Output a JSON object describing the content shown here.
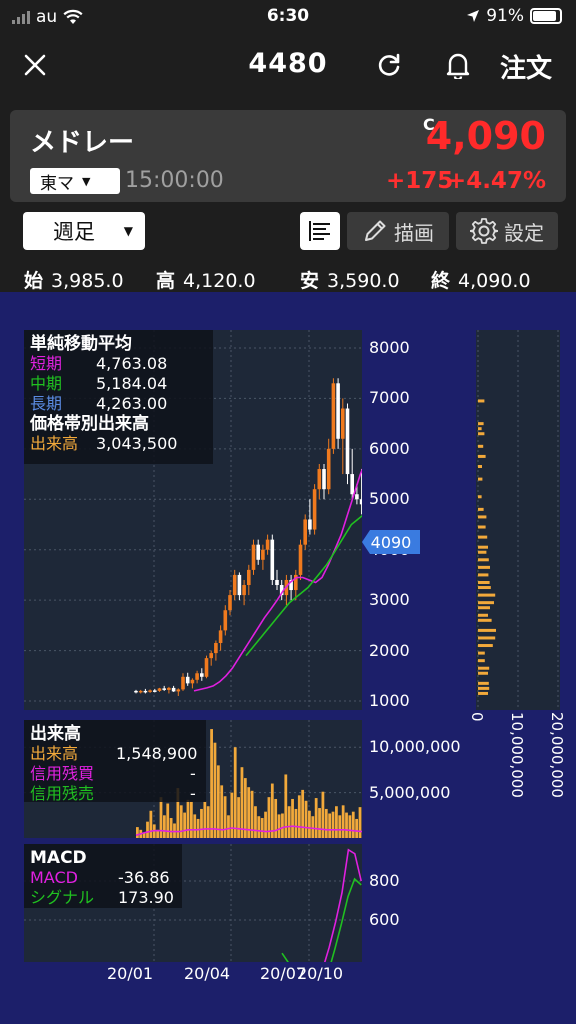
{
  "status": {
    "carrier": "au",
    "time": "6:30",
    "battery": "91%"
  },
  "header": {
    "title": "4480",
    "order_label": "注文"
  },
  "quote": {
    "name": "メドレー",
    "market": "東マ",
    "time": "15:00:00",
    "c_mark": "C",
    "price": "4,090",
    "change": "+175",
    "change_pct": "+4.47%"
  },
  "toolbar": {
    "period": "週足",
    "draw_label": "描画",
    "settings_label": "設定"
  },
  "ohlc": {
    "open_label": "始",
    "open": "3,985.0",
    "high_label": "高",
    "high": "4,120.0",
    "low_label": "安",
    "low": "3,590.0",
    "close_label": "終",
    "close": "4,090.0"
  },
  "price_legend": {
    "title": "単純移動平均",
    "short_label": "短期",
    "short": "4,763.08",
    "mid_label": "中期",
    "mid": "5,184.04",
    "long_label": "長期",
    "long": "4,263.00",
    "vbp_title": "価格帯別出来高",
    "vbp_label": "出来高",
    "vbp": "3,043,500"
  },
  "volume_legend": {
    "title": "出来高",
    "vol_label": "出来高",
    "vol": "1,548,900",
    "buy_label": "信用残買",
    "buy": "-",
    "sell_label": "信用残売",
    "sell": "-"
  },
  "macd_legend": {
    "title": "MACD",
    "macd_label": "MACD",
    "macd": "-36.86",
    "signal_label": "シグナル",
    "signal": "173.90"
  },
  "price_tag": "4090",
  "colors": {
    "up": "#f07a1e",
    "down": "#ffffff",
    "short_ma": "#e020e0",
    "mid_ma": "#20c020",
    "long_ma": "#5a8ae0",
    "volume": "#f2a93b",
    "price_red": "#ff2a2a"
  },
  "chart_data": [
    {
      "type": "candlestick",
      "title": "",
      "y_ticks": [
        "8000",
        "7000",
        "6000",
        "5000",
        "4000",
        "3000",
        "2000",
        "1000"
      ],
      "ylim": [
        1000,
        8000
      ],
      "x_ticks": [
        "20/01",
        "20/04",
        "20/07",
        "20/10"
      ],
      "candles": [
        [
          1200,
          1220,
          1150,
          1180
        ],
        [
          1180,
          1220,
          1150,
          1200
        ],
        [
          1200,
          1240,
          1150,
          1190
        ],
        [
          1190,
          1230,
          1160,
          1210
        ],
        [
          1210,
          1240,
          1170,
          1200
        ],
        [
          1200,
          1260,
          1180,
          1250
        ],
        [
          1250,
          1300,
          1200,
          1220
        ],
        [
          1220,
          1280,
          1150,
          1260
        ],
        [
          1260,
          1300,
          1180,
          1190
        ],
        [
          1190,
          1250,
          1100,
          1230
        ],
        [
          1230,
          1550,
          1200,
          1480
        ],
        [
          1480,
          1560,
          1300,
          1350
        ],
        [
          1350,
          1450,
          1250,
          1420
        ],
        [
          1420,
          1600,
          1350,
          1550
        ],
        [
          1550,
          1650,
          1400,
          1480
        ],
        [
          1480,
          1900,
          1450,
          1850
        ],
        [
          1850,
          2000,
          1700,
          1950
        ],
        [
          1950,
          2200,
          1800,
          2150
        ],
        [
          2150,
          2500,
          2000,
          2400
        ],
        [
          2400,
          2900,
          2300,
          2800
        ],
        [
          2800,
          3200,
          2700,
          3100
        ],
        [
          3100,
          3600,
          3000,
          3500
        ],
        [
          3500,
          3550,
          3000,
          3100
        ],
        [
          3100,
          3400,
          2900,
          3300
        ],
        [
          3300,
          3700,
          3100,
          3600
        ],
        [
          3600,
          4200,
          3500,
          4100
        ],
        [
          4100,
          4200,
          3700,
          3800
        ],
        [
          3800,
          4100,
          3600,
          4000
        ],
        [
          4000,
          4300,
          3900,
          4200
        ],
        [
          4200,
          4300,
          3300,
          3400
        ],
        [
          3400,
          3600,
          3200,
          3300
        ],
        [
          3300,
          3400,
          3000,
          3100
        ],
        [
          3100,
          3500,
          2900,
          3400
        ],
        [
          3400,
          3500,
          3000,
          3200
        ],
        [
          3200,
          3600,
          3000,
          3500
        ],
        [
          3500,
          4200,
          3400,
          4100
        ],
        [
          4100,
          4700,
          4000,
          4600
        ],
        [
          4600,
          5000,
          4300,
          4400
        ],
        [
          4400,
          5300,
          4300,
          5200
        ],
        [
          5200,
          5700,
          5000,
          5600
        ],
        [
          5600,
          5700,
          5000,
          5200
        ],
        [
          5200,
          6200,
          5100,
          6000
        ],
        [
          6000,
          7400,
          5900,
          7300
        ],
        [
          7300,
          7400,
          6000,
          6200
        ],
        [
          6200,
          7000,
          5500,
          6800
        ],
        [
          6800,
          6900,
          5300,
          5500
        ],
        [
          5500,
          6000,
          5000,
          5100
        ],
        [
          5100,
          5300,
          4900,
          5000
        ],
        [
          5000,
          5600,
          4700,
          4900
        ]
      ],
      "short_ma": [
        1200,
        1230,
        1260,
        1300,
        1380,
        1500,
        1650,
        1850,
        2050,
        2250,
        2450,
        2650,
        2820,
        3000,
        3200,
        3350,
        3450,
        3450,
        3400,
        3350,
        3450,
        3700,
        4000,
        4300,
        4700,
        5100,
        5500,
        5800,
        5700,
        5500
      ],
      "mid_ma": [
        1900,
        2050,
        2200,
        2350,
        2500,
        2650,
        2800,
        2950,
        3050,
        3150,
        3250,
        3400,
        3550,
        3700,
        3900,
        4100,
        4300,
        4500,
        4600,
        4700
      ],
      "volume_by_price": [
        [
          6950,
          1600000
        ],
        [
          6500,
          1400000
        ],
        [
          6400,
          900000
        ],
        [
          6300,
          1600000
        ],
        [
          6050,
          1300000
        ],
        [
          5850,
          1900000
        ],
        [
          5650,
          1000000
        ],
        [
          5400,
          1100000
        ],
        [
          5050,
          900000
        ],
        [
          4800,
          1400000
        ],
        [
          4650,
          2100000
        ],
        [
          4450,
          1900000
        ],
        [
          4250,
          2300000
        ],
        [
          4050,
          2500000
        ],
        [
          3950,
          2100000
        ],
        [
          3800,
          2700000
        ],
        [
          3650,
          3000000
        ],
        [
          3500,
          2600000
        ],
        [
          3350,
          2900000
        ],
        [
          3250,
          3200000
        ],
        [
          3100,
          4300000
        ],
        [
          2950,
          4000000
        ],
        [
          2850,
          3000000
        ],
        [
          2700,
          2500000
        ],
        [
          2600,
          3400000
        ],
        [
          2400,
          4500000
        ],
        [
          2250,
          4300000
        ],
        [
          2100,
          3700000
        ],
        [
          1950,
          1700000
        ],
        [
          1800,
          1700000
        ],
        [
          1650,
          2800000
        ],
        [
          1550,
          2500000
        ],
        [
          1350,
          2700000
        ],
        [
          1250,
          2800000
        ],
        [
          1150,
          2500000
        ]
      ],
      "vbp_x_ticks": [
        "0",
        "10,000,000",
        "20,000,000"
      ]
    },
    {
      "type": "bar",
      "title": "出来高",
      "y_ticks": [
        "10,000,000",
        "5,000,000"
      ],
      "ylim": [
        0,
        13000000
      ],
      "values": [
        1200000,
        900000,
        600000,
        1800000,
        3000000,
        1500000,
        900000,
        4500000,
        2500000,
        3800000,
        2200000,
        1600000,
        5500000,
        3600000,
        2800000,
        4200000,
        4000000,
        2600000,
        2100000,
        3200000,
        4000000,
        3500000,
        12000000,
        10500000,
        8000000,
        5800000,
        4600000,
        2500000,
        5000000,
        10000000,
        4500000,
        7800000,
        6600000,
        5600000,
        5200000,
        3500000,
        2400000,
        2200000,
        2900000,
        4500000,
        6000000,
        4300000,
        2600000,
        2700000,
        7000000,
        3500000,
        4300000,
        3200000,
        4700000,
        5300000,
        4100000,
        3000000,
        2400000,
        4400000,
        3300000,
        5100000,
        3200000,
        2700000,
        2900000,
        3500000,
        2500000,
        3600000,
        2800000,
        2500000,
        2900000,
        2100000,
        3400000
      ],
      "credit_line": [
        300000,
        600000,
        800000,
        800000,
        700000,
        700000,
        900000,
        900000,
        1000000,
        1000000,
        900000,
        1100000,
        1000000,
        900000,
        800000,
        700000,
        800000,
        1200000,
        1300000,
        1200000,
        1100000,
        1000000,
        900000,
        900000,
        900000,
        800000,
        700000
      ]
    },
    {
      "type": "line",
      "title": "MACD",
      "y_ticks": [
        "800",
        "600"
      ],
      "series": [
        {
          "name": "MACD",
          "values": [
            250,
            290,
            310,
            240,
            120,
            -10,
            -120,
            -130,
            -110,
            -20,
            100,
            230,
            350,
            460,
            590,
            740,
            960,
            940,
            800
          ]
        },
        {
          "name": "シグナル",
          "values": [
            430,
            380,
            350,
            310,
            270,
            260,
            270,
            330,
            450,
            580,
            720,
            810,
            780
          ]
        }
      ]
    }
  ]
}
